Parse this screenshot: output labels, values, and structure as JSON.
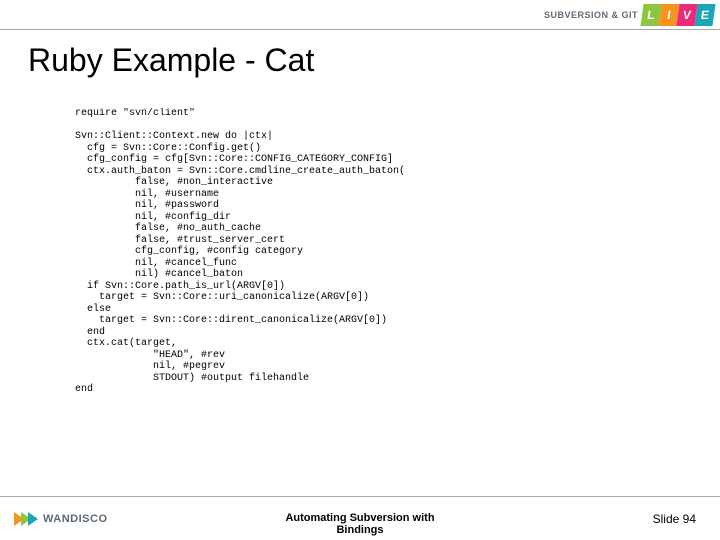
{
  "header": {
    "brand": "SUBVERSION & GIT",
    "badge": [
      "L",
      "I",
      "V",
      "E"
    ]
  },
  "title": "Ruby Example - Cat",
  "code": "require \"svn/client\"\n\nSvn::Client::Context.new do |ctx|\n  cfg = Svn::Core::Config.get()\n  cfg_config = cfg[Svn::Core::CONFIG_CATEGORY_CONFIG]\n  ctx.auth_baton = Svn::Core.cmdline_create_auth_baton(\n          false, #non_interactive\n          nil, #username\n          nil, #password\n          nil, #config_dir\n          false, #no_auth_cache\n          false, #trust_server_cert\n          cfg_config, #config category\n          nil, #cancel_func\n          nil) #cancel_baton\n  if Svn::Core.path_is_url(ARGV[0])\n    target = Svn::Core::uri_canonicalize(ARGV[0])\n  else\n    target = Svn::Core::dirent_canonicalize(ARGV[0])\n  end\n  ctx.cat(target,\n             \"HEAD\", #rev\n             nil, #pegrev\n             STDOUT) #output filehandle\nend",
  "footer": {
    "logo_text": "WANDISCO",
    "center_line1": "Automating Subversion with",
    "center_line2": "Bindings",
    "slide_label": "Slide 94"
  }
}
